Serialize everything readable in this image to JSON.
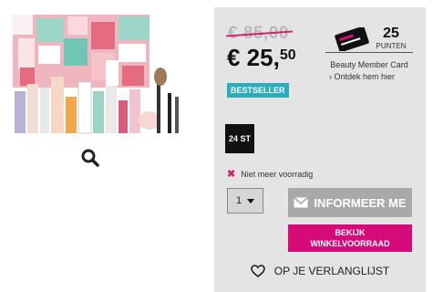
{
  "pricing": {
    "old_price": "€ 85,00",
    "new_price_main": "€ 25,",
    "new_price_cents": "50"
  },
  "loyalty": {
    "points": "25",
    "points_label": "PUNTEN",
    "card_title": "Beauty Member Card",
    "discover_link": "› Ontdek hem hier"
  },
  "badge": {
    "label": "BESTSELLER",
    "color": "#2aaebd"
  },
  "size": {
    "label": "24 ST"
  },
  "stock": {
    "icon": "x-icon",
    "text": "Niet meer voorradig"
  },
  "quantity": {
    "value": "1"
  },
  "actions": {
    "inform_label": "INFORMEER ME",
    "store_line1": "BEKIJK",
    "store_line2": "WINKELVOORRAAD",
    "wishlist_label": "OP JE VERLANGLIJST"
  },
  "colors": {
    "accent": "#d60b79",
    "badge": "#2aaebd",
    "disabled": "#a9a9a9"
  }
}
